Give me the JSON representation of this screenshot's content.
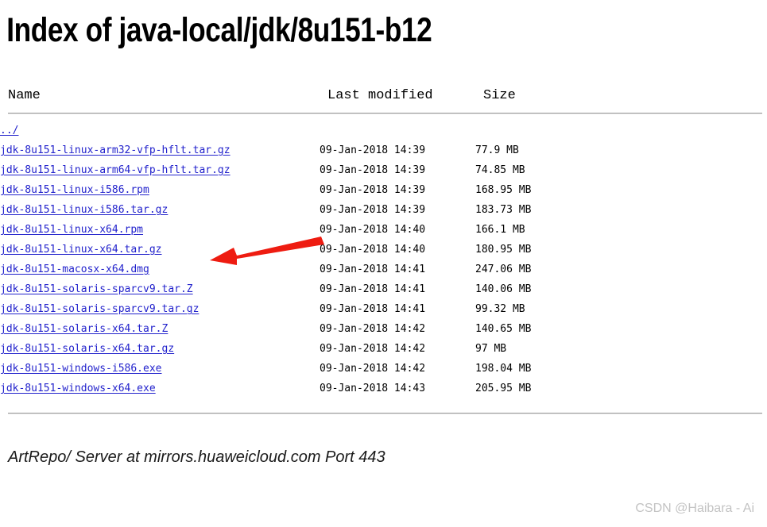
{
  "page": {
    "title": "Index of java-local/jdk/8u151-b12",
    "link_color": "#2222cc",
    "text_color": "#000000",
    "background_color": "#ffffff"
  },
  "listing": {
    "columns": {
      "name": "Name",
      "last_modified": "Last modified",
      "size": "Size"
    },
    "parent": {
      "label": "../",
      "last_modified": "",
      "size": ""
    },
    "rows": [
      {
        "name": "jdk-8u151-linux-arm32-vfp-hflt.tar.gz",
        "last_modified": "09-Jan-2018 14:39",
        "size": "77.9 MB"
      },
      {
        "name": "jdk-8u151-linux-arm64-vfp-hflt.tar.gz",
        "last_modified": "09-Jan-2018 14:39",
        "size": "74.85 MB"
      },
      {
        "name": "jdk-8u151-linux-i586.rpm",
        "last_modified": "09-Jan-2018 14:39",
        "size": "168.95 MB"
      },
      {
        "name": "jdk-8u151-linux-i586.tar.gz",
        "last_modified": "09-Jan-2018 14:39",
        "size": "183.73 MB"
      },
      {
        "name": "jdk-8u151-linux-x64.rpm",
        "last_modified": "09-Jan-2018 14:40",
        "size": "166.1 MB"
      },
      {
        "name": "jdk-8u151-linux-x64.tar.gz",
        "last_modified": "09-Jan-2018 14:40",
        "size": "180.95 MB"
      },
      {
        "name": "jdk-8u151-macosx-x64.dmg",
        "last_modified": "09-Jan-2018 14:41",
        "size": "247.06 MB"
      },
      {
        "name": "jdk-8u151-solaris-sparcv9.tar.Z",
        "last_modified": "09-Jan-2018 14:41",
        "size": "140.06 MB"
      },
      {
        "name": "jdk-8u151-solaris-sparcv9.tar.gz",
        "last_modified": "09-Jan-2018 14:41",
        "size": "99.32 MB"
      },
      {
        "name": "jdk-8u151-solaris-x64.tar.Z",
        "last_modified": "09-Jan-2018 14:42",
        "size": "140.65 MB"
      },
      {
        "name": "jdk-8u151-solaris-x64.tar.gz",
        "last_modified": "09-Jan-2018 14:42",
        "size": "97 MB"
      },
      {
        "name": "jdk-8u151-windows-i586.exe",
        "last_modified": "09-Jan-2018 14:42",
        "size": "198.04 MB"
      },
      {
        "name": "jdk-8u151-windows-x64.exe",
        "last_modified": "09-Jan-2018 14:43",
        "size": "205.95 MB"
      }
    ]
  },
  "footer": {
    "text": "ArtRepo/ Server at mirrors.huaweicloud.com Port 443"
  },
  "annotation": {
    "arrow": {
      "color": "#ee1c11",
      "points_at": "jdk-8u151-linux-x64.rpm",
      "direction": "right-to-left"
    }
  },
  "watermark": {
    "text": "CSDN @Haibara - Ai",
    "color": "#c3c3c3"
  }
}
